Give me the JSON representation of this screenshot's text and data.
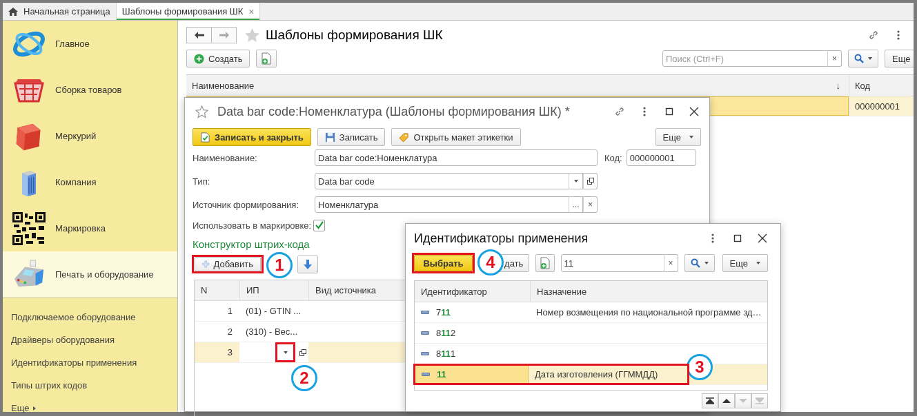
{
  "tabs": [
    {
      "label": "Начальная страница",
      "selected": false,
      "kind": "home"
    },
    {
      "label": "Шаблоны формирования ШК",
      "selected": true,
      "kind": "doc",
      "close": "×"
    }
  ],
  "sidebar": {
    "sections": [
      {
        "label": "Главное",
        "selected": false,
        "kind": "orbit"
      },
      {
        "label": "Сборка товаров",
        "selected": false,
        "kind": "basket"
      },
      {
        "label": "Меркурий",
        "selected": false,
        "kind": "cube"
      },
      {
        "label": "Компания",
        "selected": false,
        "kind": "building"
      },
      {
        "label": "Маркировка",
        "selected": false,
        "kind": "qr"
      },
      {
        "label": "Печать и оборудование",
        "selected": true,
        "kind": "terminal"
      }
    ],
    "links": [
      "Подключаемое оборудование",
      "Драйверы оборудования",
      "Идентификаторы применения",
      "Типы штрих кодов"
    ],
    "more": "Еще"
  },
  "page": {
    "title": "Шаблоны формирования ШК",
    "create": "Создать",
    "search": {
      "placeholder": "Поиск (Ctrl+F)",
      "clear": "×"
    },
    "more": "Еще",
    "columns": [
      "Наименование",
      "Код"
    ],
    "sort": "↓",
    "rows": [
      {
        "code": "000000001",
        "selected": true
      }
    ]
  },
  "dialog": {
    "title": "Data bar code:Номенклатура (Шаблоны формирования ШК) *",
    "buttons": [
      {
        "label": "Записать и закрыть",
        "kind": "primary"
      },
      {
        "label": "Записать",
        "kind": "save"
      },
      {
        "label": "Открыть макет этикетки",
        "kind": "tag"
      }
    ],
    "more": "Еще",
    "fields": [
      {
        "label": "Наименование:",
        "value": "Data bar code:Номенклатура",
        "kind": "text"
      },
      {
        "label": "Тип:",
        "value": "Data bar code",
        "kind": "select"
      },
      {
        "label": "Источник формирования:",
        "value": "Номенклатура",
        "kind": "choice",
        "choose": "...",
        "clear": "×"
      }
    ],
    "code": {
      "label": "Код:",
      "value": "000000001"
    },
    "marking": {
      "label": "Использовать в маркировке:",
      "checked": true
    },
    "section": "Конструктор штрих-кода",
    "add": "Добавить",
    "columns": [
      "N",
      "ИП",
      "Вид источника"
    ],
    "rows": [
      {
        "n": "1",
        "ip": "(01) - GTIN ...",
        "kind": "text",
        "selected": false
      },
      {
        "n": "2",
        "ip": "(310) - Вес...",
        "kind": "text",
        "selected": false
      },
      {
        "n": "3",
        "kind": "edit",
        "selected": true
      }
    ]
  },
  "picker": {
    "title": "Идентификаторы применения",
    "choose": "Выбрать",
    "create": "дать",
    "search": {
      "value": "11",
      "clear": "×"
    },
    "more": "Еще",
    "columns": [
      "Идентификатор",
      "Назначение"
    ],
    "rows": [
      {
        "id": "7**11**",
        "purpose": "Номер возмещения по национальной программе зд…",
        "selected": false
      },
      {
        "id": "8**11**2",
        "selected": false
      },
      {
        "id": "8**11**1",
        "selected": false
      },
      {
        "id": "**11**",
        "purpose": "Дата изготовления (ГГММДД)",
        "selected": true
      }
    ],
    "nav": [
      {
        "kind": "first",
        "disabled": false
      },
      {
        "kind": "up",
        "disabled": false
      },
      {
        "kind": "down",
        "disabled": true
      },
      {
        "kind": "last",
        "disabled": true
      }
    ]
  },
  "annotations": [
    {
      "label": "1"
    },
    {
      "label": "2"
    },
    {
      "label": "3"
    },
    {
      "label": "4"
    }
  ]
}
